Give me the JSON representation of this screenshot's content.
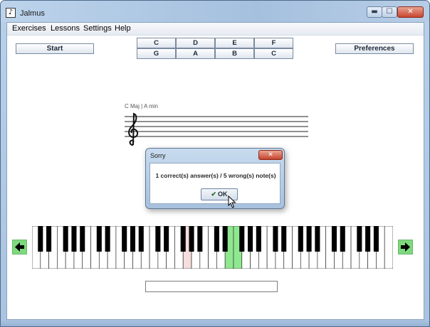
{
  "window": {
    "title": "Jalmus",
    "controls": {
      "minimize": "▬",
      "maximize": "☐",
      "close": "✕"
    },
    "app_icon": "♪"
  },
  "menu": [
    {
      "label": "Exercises"
    },
    {
      "label": "Lessons"
    },
    {
      "label": "Settings"
    },
    {
      "label": "Help"
    }
  ],
  "toolbar": {
    "start_label": "Start",
    "preferences_label": "Preferences"
  },
  "notes": {
    "row1": [
      "C",
      "D",
      "E",
      "F"
    ],
    "row2": [
      "G",
      "A",
      "B",
      "C"
    ]
  },
  "staff": {
    "key_label": "C Maj | A min",
    "clef_icon": "treble-clef-icon"
  },
  "keyboard": {
    "white_keys": 43,
    "highlight_red_key": 18,
    "highlight_green_keys": [
      23,
      24
    ],
    "colors": {
      "red": "#f7dede",
      "green": "#8fe88f"
    }
  },
  "arrows": {
    "left": "🡄",
    "right": "🡆",
    "color": "#7ed97e"
  },
  "input": {
    "value": ""
  },
  "dialog": {
    "title": "Sorry",
    "message": "1 correct(s) answer(s) / 5 wrong(s) note(s)",
    "ok_label": "OK",
    "close_symbol": "✕"
  }
}
